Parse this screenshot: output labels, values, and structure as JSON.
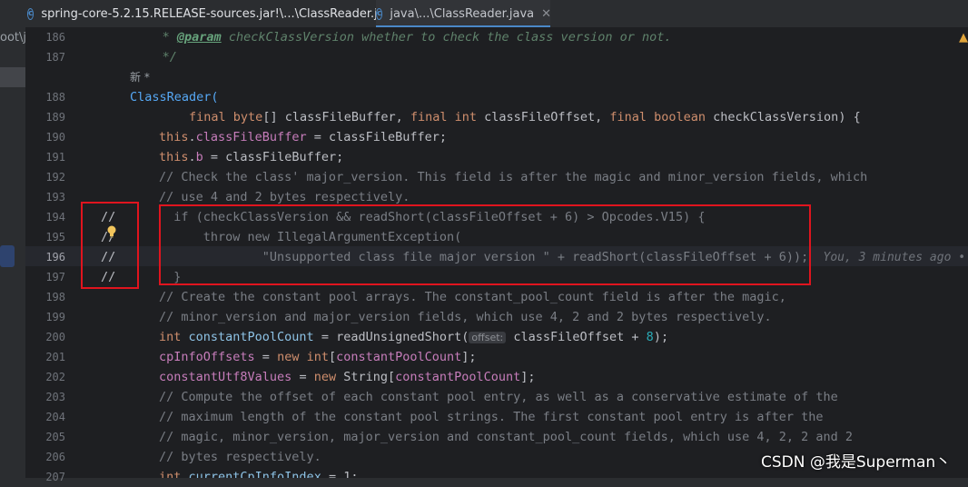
{
  "tabs": [
    {
      "label": "spring-core-5.2.15.RELEASE-sources.jar!\\...\\ClassReader.java",
      "icon": "class-icon"
    },
    {
      "label": "java\\...\\ClassReader.java",
      "icon": "class-icon",
      "close": "✕"
    }
  ],
  "left_panel": {
    "label": "oot\\j"
  },
  "inlay_new": "新 *",
  "line_numbers": [
    "186",
    "187",
    "188",
    "189",
    "190",
    "191",
    "192",
    "193",
    "194",
    "195",
    "196",
    "197",
    "198",
    "199",
    "200",
    "201",
    "202",
    "203",
    "204",
    "205",
    "206",
    "207"
  ],
  "code": {
    "l186_prefix": "     * ",
    "l186_tag": "@param",
    "l186_rest": " checkClassVersion whether to check the class version or not.",
    "l187": "     */",
    "l188": "ClassReader(",
    "l189_a": "        final byte",
    "l189_b": "[] classFileBuffer, ",
    "l189_c": "final int",
    "l189_d": " classFileOffset, ",
    "l189_e": "final boolean",
    "l189_f": " checkClassVersion) {",
    "l190_a": "this",
    "l190_b": ".",
    "l190_c": "classFileBuffer",
    "l190_d": " = classFileBuffer;",
    "l191_a": "this",
    "l191_b": ".",
    "l191_c": "b",
    "l191_d": " = classFileBuffer;",
    "l192": "// Check the class' major_version. This field is after the magic and minor_version fields, which",
    "l193": "// use 4 and 2 bytes respectively.",
    "l194": "  if (checkClassVersion && readShort(classFileOffset + 6) > Opcodes.V15) {",
    "l195": "      throw new IllegalArgumentException(",
    "l196": "              \"Unsupported class file major version \" + readShort(classFileOffset + 6));",
    "l196_blame": "You, 3 minutes ago •",
    "l197": "  }",
    "l198": "// Create the constant pool arrays. The constant_pool_count field is after the magic,",
    "l199": "// minor_version and major_version fields, which use 4, 2 and 2 bytes respectively.",
    "l200_a": "int",
    "l200_b": " constantPoolCount",
    "l200_c": " = ",
    "l200_d": "readUnsignedShort(",
    "l200_hint": "offset:",
    "l200_e": " classFileOffset + ",
    "l200_f": "8",
    "l200_g": ");",
    "l201_a": "cpInfoOffsets",
    "l201_b": " = ",
    "l201_c": "new int",
    "l201_d": "[",
    "l201_e": "constantPoolCount",
    "l201_f": "];",
    "l202_a": "constantUtf8Values",
    "l202_b": " = ",
    "l202_c": "new",
    "l202_d": " String[",
    "l202_e": "constantPoolCount",
    "l202_f": "];",
    "l203": "// Compute the offset of each constant pool entry, as well as a conservative estimate of the",
    "l204": "// maximum length of the constant pool strings. The first constant pool entry is after the",
    "l205": "// magic, minor_version, major_version and constant_pool_count fields, which use 4, 2, 2 and 2",
    "l206": "// bytes respectively.",
    "l207_a": "int",
    "l207_b": " currentCpInfoIndex",
    "l207_c": " = 1;"
  },
  "comment_marks": [
    "//",
    "//",
    "//",
    "//"
  ],
  "watermark": "CSDN @我是Superman丶",
  "colors": {
    "keyword": "#cf8e6d",
    "comment": "#7a7e85",
    "field": "#c77dbb",
    "string": "#6aab73",
    "highlight_box": "#e0141e"
  }
}
